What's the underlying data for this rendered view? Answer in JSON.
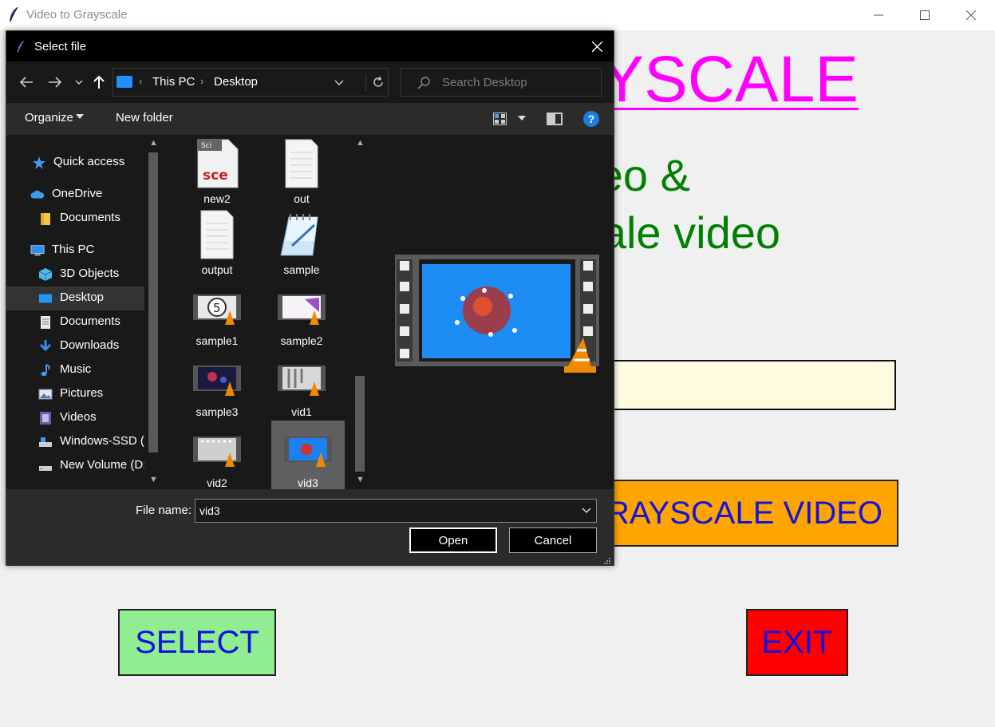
{
  "window": {
    "title": "Video to Grayscale",
    "icon": "feather-icon"
  },
  "app": {
    "heading": "VIDEO TO GRAYSCALE",
    "desc_line1": "Select any video &",
    "desc_line2": "convert to grayscale video",
    "path_value": "",
    "convert_label": "GRAYSCALE VIDEO",
    "select_label": "SELECT",
    "exit_label": "EXIT",
    "colors": {
      "heading": "#ff00ff",
      "desc": "#008000",
      "convert_bg": "#ffa500",
      "select_bg": "#90ee90",
      "exit_bg": "#ff0000",
      "button_text": "#1010e0"
    }
  },
  "dialog": {
    "title": "Select file",
    "breadcrumb": [
      "This PC",
      "Desktop"
    ],
    "search_placeholder": "Search Desktop",
    "toolbar": {
      "organize": "Organize",
      "new_folder": "New folder"
    },
    "nav_items": [
      {
        "label": "Quick access",
        "icon": "star-icon"
      },
      {
        "label": "OneDrive",
        "icon": "cloud-icon"
      },
      {
        "label": "Documents",
        "icon": "folder-icon"
      },
      {
        "label": "This PC",
        "icon": "computer-icon"
      },
      {
        "label": "3D Objects",
        "icon": "cube-icon"
      },
      {
        "label": "Desktop",
        "icon": "desktop-icon"
      },
      {
        "label": "Documents",
        "icon": "document-icon"
      },
      {
        "label": "Downloads",
        "icon": "download-arrow-icon"
      },
      {
        "label": "Music",
        "icon": "music-note-icon"
      },
      {
        "label": "Pictures",
        "icon": "pictures-icon"
      },
      {
        "label": "Videos",
        "icon": "videos-icon"
      },
      {
        "label": "Windows-SSD (C:)",
        "icon": "drive-icon"
      },
      {
        "label": "New Volume (D:)",
        "icon": "drive-icon"
      }
    ],
    "selected_nav": "Desktop",
    "files": [
      {
        "label": "new2",
        "icon": "sce-file-icon"
      },
      {
        "label": "out",
        "icon": "text-file-icon"
      },
      {
        "label": "output",
        "icon": "text-file-icon"
      },
      {
        "label": "sample",
        "icon": "notepad-icon"
      },
      {
        "label": "sample1",
        "icon": "video-file-icon"
      },
      {
        "label": "sample2",
        "icon": "video-file-icon"
      },
      {
        "label": "sample3",
        "icon": "video-file-icon"
      },
      {
        "label": "vid1",
        "icon": "video-file-icon"
      },
      {
        "label": "vid2",
        "icon": "video-file-icon"
      },
      {
        "label": "vid3",
        "icon": "video-file-icon"
      }
    ],
    "selected_file": "vid3",
    "file_name_label": "File name:",
    "file_name_value": "vid3",
    "open_label": "Open",
    "cancel_label": "Cancel"
  }
}
